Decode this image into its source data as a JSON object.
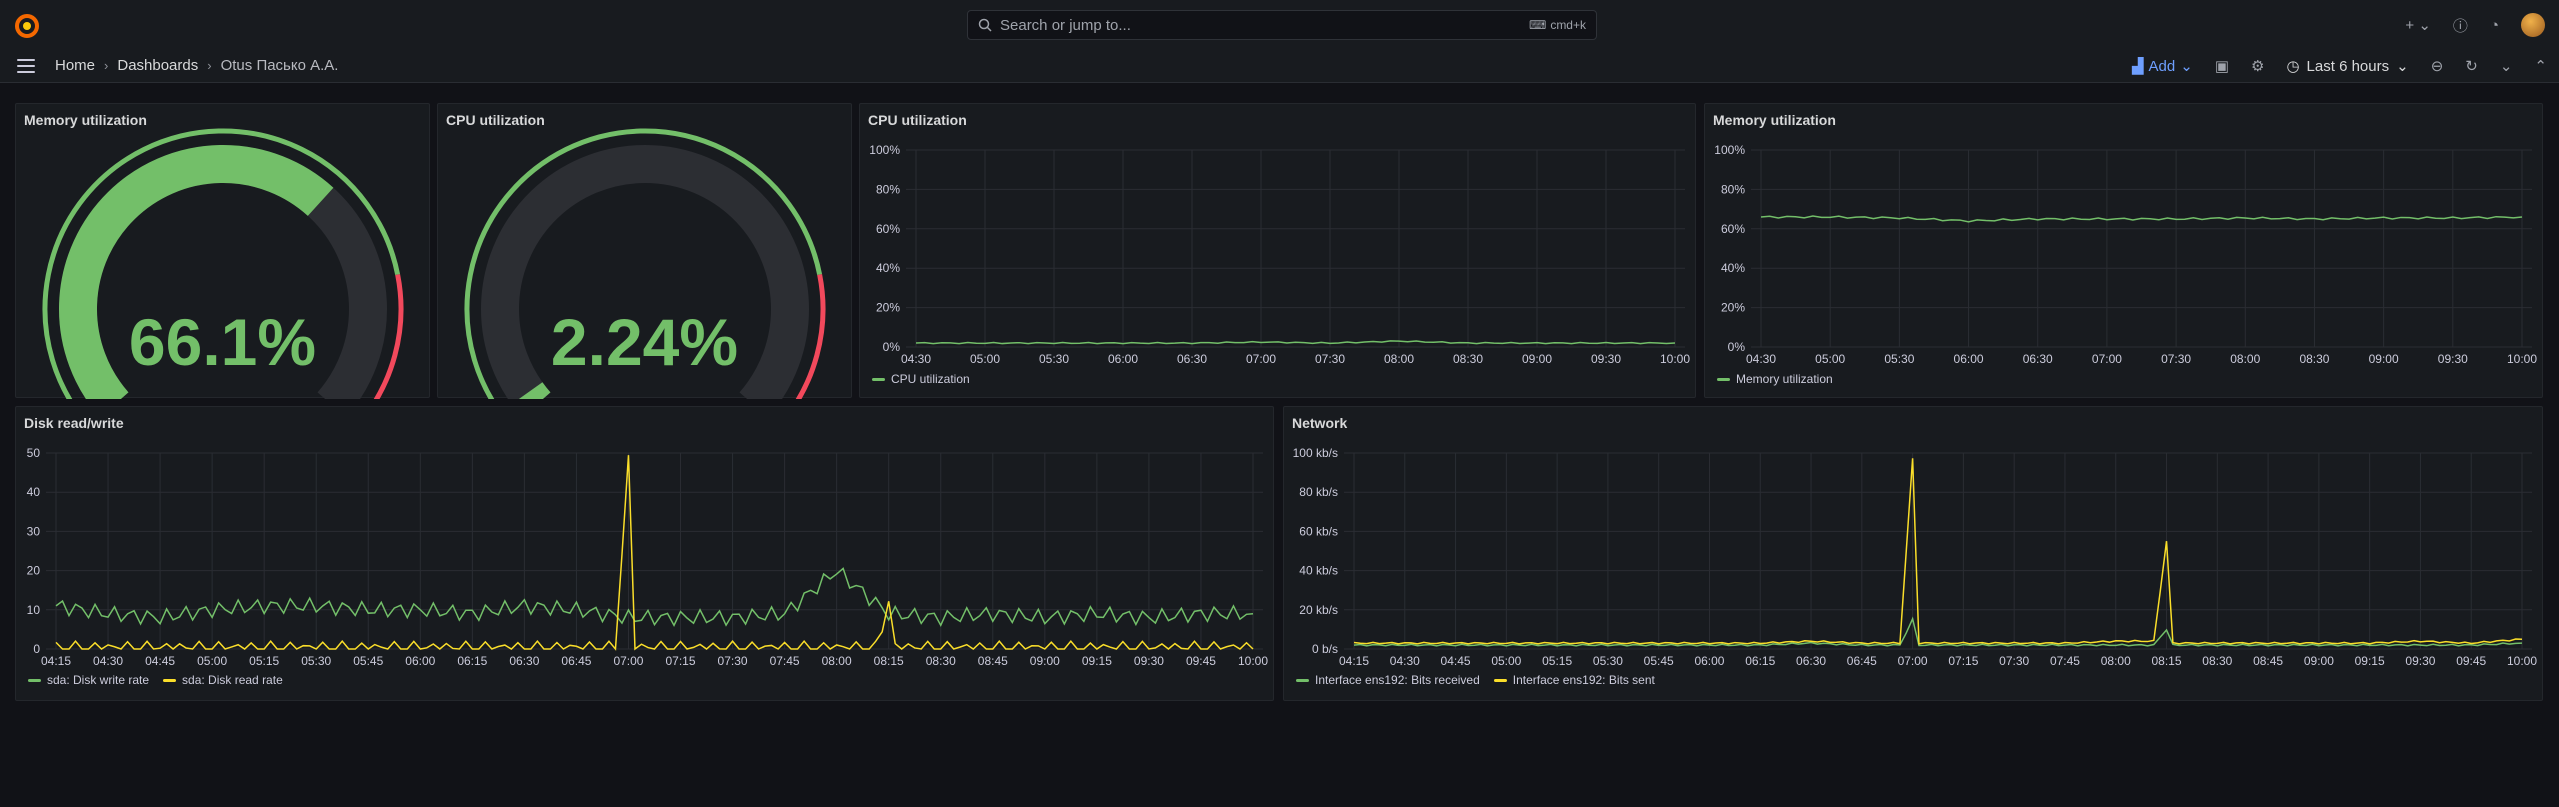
{
  "topbar": {
    "search_placeholder": "Search or jump to...",
    "shortcut": "cmd+k",
    "icons": [
      "grafana-logo-icon",
      "search-icon",
      "plus-icon",
      "help-icon",
      "rss-icon",
      "avatar"
    ]
  },
  "navbar": {
    "breadcrumbs": [
      "Home",
      "Dashboards",
      "Otus Пасько А.А."
    ],
    "add_label": "Add",
    "time_range": "Last 6 hours"
  },
  "colors": {
    "green": "#73bf69",
    "yellow": "#fade2a",
    "red": "#f2495c",
    "background": "#111217",
    "panel": "#181b1f"
  },
  "panels": {
    "mem_gauge": {
      "title": "Memory utilization",
      "value_text": "66.1%",
      "value": 66.1
    },
    "cpu_gauge": {
      "title": "CPU utilization",
      "value_text": "2.24%",
      "value": 2.24
    },
    "cpu_ts": {
      "title": "CPU utilization",
      "legend": [
        "CPU utilization"
      ]
    },
    "mem_ts": {
      "title": "Memory utilization",
      "legend": [
        "Memory utilization"
      ]
    },
    "disk": {
      "title": "Disk read/write",
      "legend": [
        "sda: Disk write rate",
        "sda: Disk read rate"
      ]
    },
    "net": {
      "title": "Network",
      "legend": [
        "Interface ens192: Bits received",
        "Interface ens192: Bits sent"
      ]
    }
  },
  "chart_data": [
    {
      "type": "line",
      "title": "CPU utilization",
      "x": [
        "04:30",
        "05:00",
        "05:30",
        "06:00",
        "06:30",
        "07:00",
        "07:30",
        "08:00",
        "08:30",
        "09:00",
        "09:30",
        "10:00"
      ],
      "ylim": [
        0,
        100
      ],
      "yticks": [
        "0%",
        "20%",
        "40%",
        "60%",
        "80%",
        "100%"
      ],
      "series": [
        {
          "name": "CPU utilization",
          "values": [
            2,
            2,
            2,
            2,
            2,
            2.5,
            2,
            3,
            2,
            2,
            2,
            2
          ]
        }
      ]
    },
    {
      "type": "line",
      "title": "Memory utilization",
      "x": [
        "04:30",
        "05:00",
        "05:30",
        "06:00",
        "06:30",
        "07:00",
        "07:30",
        "08:00",
        "08:30",
        "09:00",
        "09:30",
        "10:00"
      ],
      "ylim": [
        0,
        100
      ],
      "yticks": [
        "0%",
        "20%",
        "40%",
        "60%",
        "80%",
        "100%"
      ],
      "series": [
        {
          "name": "Memory utilization",
          "values": [
            66,
            66,
            65.5,
            64,
            65,
            65,
            65,
            65.5,
            65,
            65.5,
            65.5,
            66
          ]
        }
      ]
    },
    {
      "type": "line",
      "title": "Disk read/write",
      "x": [
        "04:15",
        "04:30",
        "04:45",
        "05:00",
        "05:15",
        "05:30",
        "05:45",
        "06:00",
        "06:15",
        "06:30",
        "06:45",
        "07:00",
        "07:15",
        "07:30",
        "07:45",
        "08:00",
        "08:15",
        "08:30",
        "08:45",
        "09:00",
        "09:15",
        "09:30",
        "09:45",
        "10:00"
      ],
      "ylim": [
        0,
        50
      ],
      "yticks": [
        "0",
        "10",
        "20",
        "30",
        "40",
        "50"
      ],
      "series": [
        {
          "name": "sda: Disk write rate",
          "values": [
            11,
            9,
            8,
            10,
            11,
            11,
            10,
            10,
            9,
            11,
            10,
            8,
            8,
            8,
            9,
            20,
            9,
            8,
            9,
            8,
            9,
            8,
            9,
            9
          ]
        },
        {
          "name": "sda: Disk read rate",
          "values": [
            0,
            0,
            0,
            0,
            0,
            0,
            0,
            0,
            0,
            0,
            0,
            48,
            0,
            0,
            0,
            0,
            12,
            0,
            0,
            0,
            0,
            0,
            0,
            0
          ]
        }
      ]
    },
    {
      "type": "line",
      "title": "Network",
      "x": [
        "04:15",
        "04:30",
        "04:45",
        "05:00",
        "05:15",
        "05:30",
        "05:45",
        "06:00",
        "06:15",
        "06:30",
        "06:45",
        "07:00",
        "07:15",
        "07:30",
        "07:45",
        "08:00",
        "08:15",
        "08:30",
        "08:45",
        "09:00",
        "09:15",
        "09:30",
        "09:45",
        "10:00"
      ],
      "ylim": [
        0,
        100
      ],
      "yticks": [
        "0 b/s",
        "20 kb/s",
        "40 kb/s",
        "60 kb/s",
        "80 kb/s",
        "100 kb/s"
      ],
      "series": [
        {
          "name": "Interface ens192: Bits received",
          "values": [
            2,
            2,
            2,
            2,
            2,
            2,
            2,
            2,
            2,
            3,
            2,
            15,
            2,
            2,
            2,
            2,
            10,
            2,
            2,
            2,
            2,
            2,
            2,
            3
          ]
        },
        {
          "name": "Interface ens192: Bits sent",
          "values": [
            3,
            3,
            3,
            3,
            3,
            3,
            3,
            3,
            3,
            4,
            3,
            97,
            3,
            3,
            3,
            4,
            55,
            3,
            3,
            3,
            3,
            4,
            3,
            5
          ]
        }
      ]
    }
  ]
}
